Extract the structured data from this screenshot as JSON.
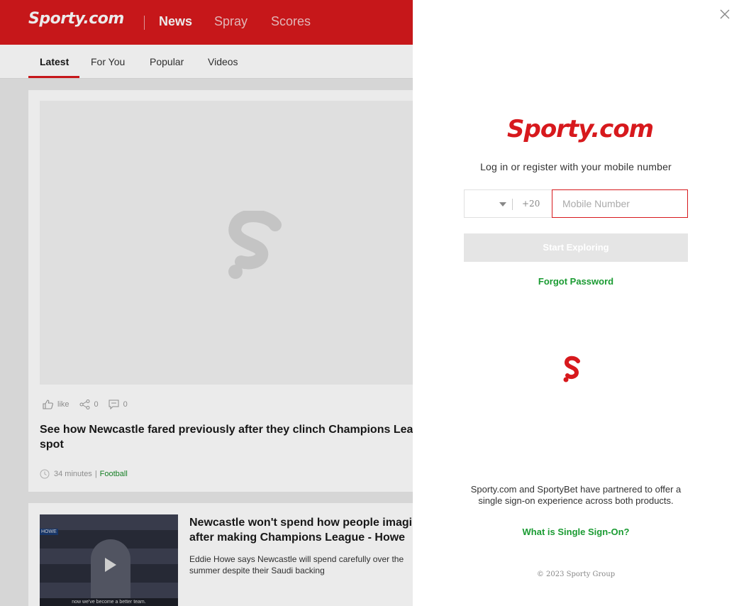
{
  "header": {
    "logo": "Sporty.com",
    "nav": [
      "News",
      "Spray",
      "Scores"
    ],
    "active_nav": "News"
  },
  "subnav": {
    "tabs": [
      "Latest",
      "For You",
      "Popular",
      "Videos"
    ],
    "active_tab": "Latest"
  },
  "articles": [
    {
      "like_label": "like",
      "shares": "0",
      "comments": "0",
      "headline": "See how Newcastle fared previously after they clinch Champions League spot",
      "time": "34 minutes",
      "category": "Football"
    },
    {
      "headline": "Newcastle won't spend how people imagine after making Champions League - Howe",
      "summary": "Eddie Howe says Newcastle will spend carefully over the summer despite their Saudi backing",
      "thumb_tag": "HOWE",
      "thumb_caption": "now we've become a better team."
    }
  ],
  "login": {
    "logo": "Sporty.com",
    "prompt": "Log in or register with your mobile number",
    "country_code": "+20",
    "mobile_placeholder": "Mobile Number",
    "start_button": "Start Exploring",
    "forgot_password": "Forgot Password",
    "partner_text": "Sporty.com and SportyBet have partnered to offer a single sign-on experience across both products.",
    "sso_link": "What is Single Sign-On?",
    "copyright": "© 2023 Sporty Group"
  },
  "colors": {
    "brand_red": "#d7191d",
    "link_green": "#1a9b32",
    "category_green": "#1a8b2a"
  },
  "icons": [
    "close-icon",
    "like-icon",
    "share-icon",
    "comment-icon",
    "clock-icon",
    "play-icon",
    "sporty-s-icon",
    "loading-icon",
    "caret-down-icon"
  ]
}
